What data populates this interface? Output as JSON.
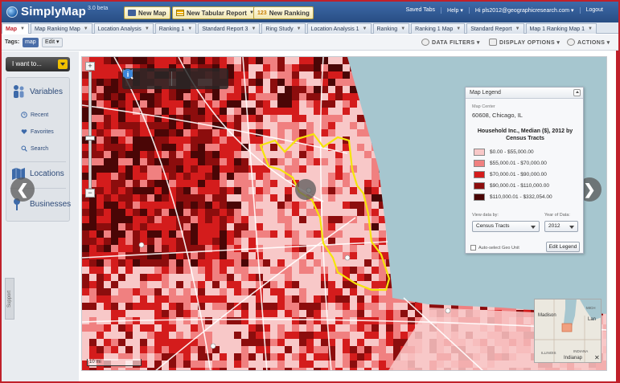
{
  "app": {
    "name": "SimplyMap",
    "version": "3.0 beta"
  },
  "top_buttons": {
    "new_map": "New Map",
    "new_tabular": "New Tabular Report",
    "new_ranking": "New Ranking"
  },
  "user_bar": {
    "saved_tabs": "Saved Tabs",
    "help": "Help ▾",
    "user": "Hi pls2012@geographicresearch.com ▾",
    "logout": "Logout"
  },
  "tabs": [
    {
      "label": "Map",
      "active": true
    },
    {
      "label": "Map Ranking Map",
      "active": false
    },
    {
      "label": "Location Analysis",
      "active": false
    },
    {
      "label": "Ranking 1",
      "active": false
    },
    {
      "label": "Standard Report 3",
      "active": false
    },
    {
      "label": "Ring Study",
      "active": false
    },
    {
      "label": "Location Analysis 1",
      "active": false
    },
    {
      "label": "Ranking",
      "active": false
    },
    {
      "label": "Ranking 1 Map",
      "active": false
    },
    {
      "label": "Standard Report",
      "active": false
    },
    {
      "label": "Map 1 Ranking Map 1",
      "active": false
    }
  ],
  "toolbar": {
    "tags_label": "Tags:",
    "tag_map": "map",
    "tag_edit": "Edit ▾",
    "data_filters": "DATA FILTERS ▾",
    "display_options": "DISPLAY OPTIONS ▾",
    "actions": "ACTIONS ▾"
  },
  "left_panel": {
    "i_want_to": "I want to...",
    "variables": "Variables",
    "recent": "Recent",
    "favorites": "Favorites",
    "search": "Search",
    "locations": "Locations",
    "businesses": "Businesses",
    "support": "Support"
  },
  "map": {
    "scale": "10 mi",
    "nav_prev": "❮",
    "nav_next": "❯"
  },
  "legend": {
    "header": "Map Legend",
    "center_label": "Map Center",
    "center_value": "60608, Chicago, IL",
    "title": "Household Inc., Median ($), 2012 by Census Tracts",
    "classes": [
      {
        "label": "$0.00 - $55,000.00",
        "color": "#f8c8c8"
      },
      {
        "label": "$55,000.01 - $70,000.00",
        "color": "#f08080"
      },
      {
        "label": "$70,000.01 - $90,000.00",
        "color": "#d41c1c"
      },
      {
        "label": "$90,000.01 - $110,000.00",
        "color": "#8c0d0d"
      },
      {
        "label": "$110,000.01 - $332,054.00",
        "color": "#4a0606"
      }
    ],
    "view_data_by_label": "View data by:",
    "view_data_by_value": "Census Tracts",
    "year_label": "Year of Data:",
    "year_value": "2012",
    "auto_select": "Auto-select Geo Unit",
    "edit_legend": "Edit Legend"
  },
  "overview": {
    "madison": "Madison",
    "lansing": "Lan",
    "indianapolis": "Indianap",
    "illinois": "ILLINOIS",
    "indiana": "INDIANA",
    "mich": "MICH"
  },
  "colors": {
    "accent": "#c0202a",
    "brand": "#3d6aa9",
    "lake": "#a6c6cf"
  }
}
